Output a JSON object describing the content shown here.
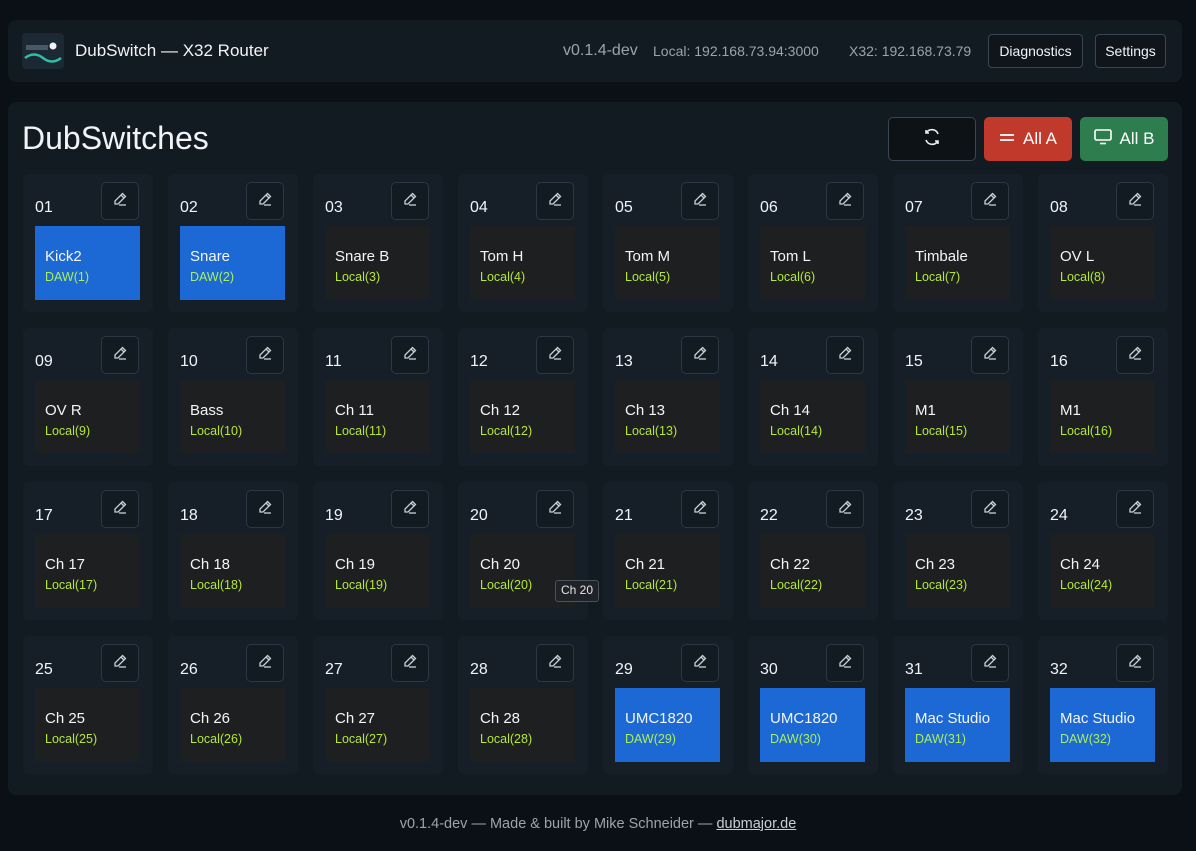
{
  "header": {
    "title": "DubSwitch — X32 Router",
    "version": "v0.1.4-dev",
    "local": "Local: 192.168.73.94:3000",
    "x32": "X32: 192.168.73.79",
    "diagnostics_label": "Diagnostics",
    "settings_label": "Settings"
  },
  "main": {
    "title": "DubSwitches",
    "all_a_label": "All A",
    "all_b_label": "All B",
    "colors": {
      "daw": "#1c68d4",
      "local": "#1e1f20",
      "all_a": "#c0392b",
      "all_b": "#2e7d4f",
      "source_text": "#b5e83a"
    }
  },
  "channels": [
    {
      "num": "01",
      "name": "Kick2",
      "source": "DAW(1)",
      "mode": "daw"
    },
    {
      "num": "02",
      "name": "Snare",
      "source": "DAW(2)",
      "mode": "daw"
    },
    {
      "num": "03",
      "name": "Snare B",
      "source": "Local(3)",
      "mode": "local"
    },
    {
      "num": "04",
      "name": "Tom H",
      "source": "Local(4)",
      "mode": "local"
    },
    {
      "num": "05",
      "name": "Tom M",
      "source": "Local(5)",
      "mode": "local"
    },
    {
      "num": "06",
      "name": "Tom L",
      "source": "Local(6)",
      "mode": "local"
    },
    {
      "num": "07",
      "name": "Timbale",
      "source": "Local(7)",
      "mode": "local"
    },
    {
      "num": "08",
      "name": "OV L",
      "source": "Local(8)",
      "mode": "local"
    },
    {
      "num": "09",
      "name": "OV R",
      "source": "Local(9)",
      "mode": "local"
    },
    {
      "num": "10",
      "name": "Bass",
      "source": "Local(10)",
      "mode": "local"
    },
    {
      "num": "11",
      "name": "Ch 11",
      "source": "Local(11)",
      "mode": "local"
    },
    {
      "num": "12",
      "name": "Ch 12",
      "source": "Local(12)",
      "mode": "local"
    },
    {
      "num": "13",
      "name": "Ch 13",
      "source": "Local(13)",
      "mode": "local"
    },
    {
      "num": "14",
      "name": "Ch 14",
      "source": "Local(14)",
      "mode": "local"
    },
    {
      "num": "15",
      "name": "M1",
      "source": "Local(15)",
      "mode": "local"
    },
    {
      "num": "16",
      "name": "M1",
      "source": "Local(16)",
      "mode": "local"
    },
    {
      "num": "17",
      "name": "Ch 17",
      "source": "Local(17)",
      "mode": "local"
    },
    {
      "num": "18",
      "name": "Ch 18",
      "source": "Local(18)",
      "mode": "local"
    },
    {
      "num": "19",
      "name": "Ch 19",
      "source": "Local(19)",
      "mode": "local"
    },
    {
      "num": "20",
      "name": "Ch 20",
      "source": "Local(20)",
      "mode": "local"
    },
    {
      "num": "21",
      "name": "Ch 21",
      "source": "Local(21)",
      "mode": "local"
    },
    {
      "num": "22",
      "name": "Ch 22",
      "source": "Local(22)",
      "mode": "local"
    },
    {
      "num": "23",
      "name": "Ch 23",
      "source": "Local(23)",
      "mode": "local"
    },
    {
      "num": "24",
      "name": "Ch 24",
      "source": "Local(24)",
      "mode": "local"
    },
    {
      "num": "25",
      "name": "Ch 25",
      "source": "Local(25)",
      "mode": "local"
    },
    {
      "num": "26",
      "name": "Ch 26",
      "source": "Local(26)",
      "mode": "local"
    },
    {
      "num": "27",
      "name": "Ch 27",
      "source": "Local(27)",
      "mode": "local"
    },
    {
      "num": "28",
      "name": "Ch 28",
      "source": "Local(28)",
      "mode": "local"
    },
    {
      "num": "29",
      "name": "UMC1820",
      "source": "DAW(29)",
      "mode": "daw"
    },
    {
      "num": "30",
      "name": "UMC1820",
      "source": "DAW(30)",
      "mode": "daw"
    },
    {
      "num": "31",
      "name": "Mac Studio",
      "source": "DAW(31)",
      "mode": "daw"
    },
    {
      "num": "32",
      "name": "Mac Studio",
      "source": "DAW(32)",
      "mode": "daw"
    }
  ],
  "tooltip": "Ch 20",
  "footer": {
    "text": "v0.1.4-dev — Made & built by Mike Schneider — ",
    "link": "dubmajor.de"
  }
}
